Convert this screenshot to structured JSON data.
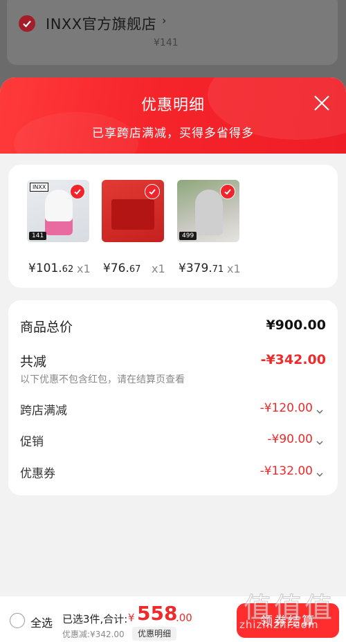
{
  "background": {
    "shop_name": "INXX官方旗舰店",
    "shop_arrow": "›",
    "shop_price": "¥141"
  },
  "sheet": {
    "title": "优惠明细",
    "subtitle": "已享跨店满减，买得多省得多"
  },
  "products": [
    {
      "price_int": "¥101.",
      "price_dec": "62",
      "qty": "x1",
      "badge": "141",
      "brand": "INXX"
    },
    {
      "price_int": "¥76.",
      "price_dec": "67",
      "qty": "x1",
      "badge": "",
      "brand": ""
    },
    {
      "price_int": "¥379.",
      "price_dec": "71",
      "qty": "x1",
      "badge": "499",
      "brand": ""
    }
  ],
  "summary": {
    "total_label": "商品总价",
    "total_value": "¥900.00",
    "reduce_label": "共减",
    "reduce_value": "-¥342.00",
    "reduce_note": "以下优惠不包含红包，请在结算页查看",
    "items": [
      {
        "label": "跨店满减",
        "value": "-¥120.00"
      },
      {
        "label": "促销",
        "value": "-¥90.00"
      },
      {
        "label": "优惠券",
        "value": "-¥132.00"
      }
    ]
  },
  "bottom": {
    "select_all": "全选",
    "selected_count": "已选3件,合计:",
    "currency": "¥",
    "total_int": "558",
    "total_dec": ".00",
    "discount": "优惠减:¥342.00",
    "detail_chip": "优惠明细",
    "checkout": "领券结算"
  },
  "watermark": {
    "logo": "值值值",
    "url": "zhizhizhi.com"
  },
  "colors": {
    "accent": "#f0242c",
    "price_red": "#ee2a2a"
  }
}
